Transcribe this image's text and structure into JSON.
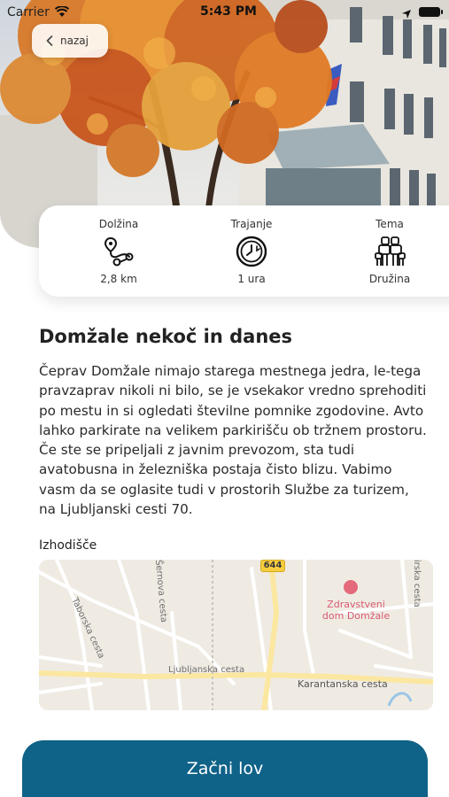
{
  "status_bar": {
    "carrier": "Carrier",
    "time": "5:43 PM"
  },
  "header": {
    "back_label": "nazaj"
  },
  "info": {
    "length": {
      "title": "Dolžina",
      "value": "2,8 km",
      "icon": "route-icon"
    },
    "duration": {
      "title": "Trajanje",
      "value": "1 ura",
      "icon": "clock-icon"
    },
    "theme": {
      "title": "Tema",
      "value": "Družina",
      "icon": "family-icon"
    }
  },
  "tour": {
    "title": "Domžale nekoč in danes",
    "description": "Čeprav Domžale nimajo starega mestnega jedra, le-tega pravzaprav nikoli ni bilo, se je vsekakor vredno sprehoditi po mestu in si ogledati številne pomnike zgodovine. Avto lahko parkirate na velikem parkirišču ob tržnem prostoru. Če ste se pripeljali z javnim prevozom, sta tudi avatobusna in železniška postaja čisto blizu. Vabimo vasm da se oglasite tudi v prostorih Službe za turizem, na Ljubljanski cesti 70."
  },
  "start_point": {
    "label": "Izhodišče",
    "map": {
      "road_number": "644",
      "poi": "Zdravstveni dom Domžale",
      "streets": [
        "Šernova cesta",
        "Taborska cesta",
        "Ljubljanska cesta",
        "Karantanska cesta",
        "Virska cesta"
      ]
    }
  },
  "cta": {
    "label": "Začni lov"
  },
  "colors": {
    "primary": "#0f6288",
    "poi": "#e46a7b",
    "road_badge": "#f6cd3f"
  }
}
